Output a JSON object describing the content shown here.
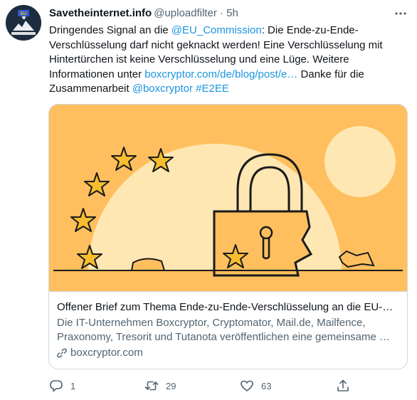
{
  "tweet": {
    "author_name": "Savetheinternet.info",
    "author_handle": "@uploadfilter",
    "separator": "·",
    "time": "5h",
    "avatar_badge": "EU",
    "text": {
      "p1": "Dringendes Signal an die ",
      "mention1": "@EU_Commission",
      "p2": ": Die Ende-zu-Ende-Verschlüsselung darf nicht geknackt werden! Eine Verschlüsselung mit Hintertürchen ist keine Verschlüsselung und eine Lüge. Weitere Informationen unter ",
      "url": "boxcryptor.com/de/blog/post/e…",
      "p3": " Danke für die Zusammenarbeit ",
      "mention2": "@boxcryptor",
      "hashtag": "#E2EE"
    }
  },
  "card": {
    "title": "Offener Brief zum Thema Ende-zu-Ende-Verschlüsselung an die EU-Ko…",
    "desc_line1": "Die IT-Unternehmen Boxcryptor, Cryptomator, Mail.de, Mailfence,",
    "desc_line2": "Praxonomy, Tresorit und Tutanota veröffentlichen eine gemeinsame …",
    "domain": "boxcryptor.com"
  },
  "actions": {
    "reply_count": "1",
    "retweet_count": "29",
    "like_count": "63"
  },
  "icons": {
    "more": "more-horizontal-icon",
    "reply": "reply-icon",
    "retweet": "retweet-icon",
    "like": "heart-icon",
    "share": "share-icon",
    "link": "link-icon"
  },
  "colors": {
    "link": "#1b95e0",
    "muted": "#536471",
    "card_background": "#ffbf5f",
    "illustration_cream": "#ffe7b3",
    "star": "#f6bd2e"
  }
}
